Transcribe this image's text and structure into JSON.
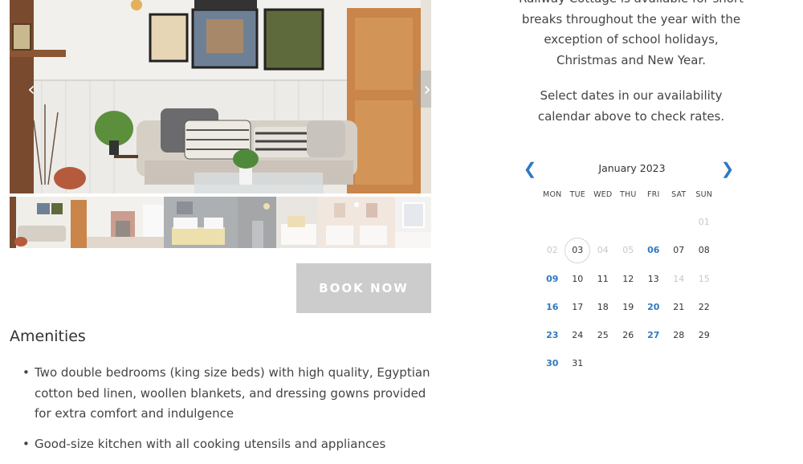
{
  "gallery": {
    "prev_icon": "chevron-left-icon",
    "next_icon": "chevron-right-icon",
    "thumbnails": [
      "living-room",
      "fireplace-room",
      "bedroom-yellow",
      "bedroom-dark",
      "bedroom-white",
      "bedroom-twin",
      "window-room"
    ]
  },
  "booking": {
    "button_label": "BOOK NOW"
  },
  "amenities": {
    "title": "Amenities",
    "items": [
      "Two double bedrooms (king size beds) with high quality, Egyptian cotton bed linen, woollen blankets, and dressing gowns provided for extra comfort and indulgence",
      "Good-size kitchen with all cooking utensils and appliances"
    ]
  },
  "info": {
    "paragraph1": "Railway Cottage is available for short breaks throughout the year with the exception of school holidays, Christmas and New Year.",
    "paragraph2": "Select dates in our availability calendar above to check rates."
  },
  "calendar": {
    "month": "January 2023",
    "prev_icon": "chevron-left-icon",
    "next_icon": "chevron-right-icon",
    "weekdays": [
      "MON",
      "TUE",
      "WED",
      "THU",
      "FRI",
      "SAT",
      "SUN"
    ],
    "accent_color": "#2e79c0",
    "weeks": [
      [
        {
          "d": ""
        },
        {
          "d": ""
        },
        {
          "d": ""
        },
        {
          "d": ""
        },
        {
          "d": ""
        },
        {
          "d": ""
        },
        {
          "d": "01",
          "s": "dim"
        }
      ],
      [
        {
          "d": "02",
          "s": "dim"
        },
        {
          "d": "03",
          "s": "today"
        },
        {
          "d": "04",
          "s": "dim"
        },
        {
          "d": "05",
          "s": "dim"
        },
        {
          "d": "06",
          "s": "avail"
        },
        {
          "d": "07"
        },
        {
          "d": "08"
        }
      ],
      [
        {
          "d": "09",
          "s": "avail"
        },
        {
          "d": "10"
        },
        {
          "d": "11"
        },
        {
          "d": "12"
        },
        {
          "d": "13"
        },
        {
          "d": "14",
          "s": "dim"
        },
        {
          "d": "15",
          "s": "dim"
        }
      ],
      [
        {
          "d": "16",
          "s": "avail"
        },
        {
          "d": "17"
        },
        {
          "d": "18"
        },
        {
          "d": "19"
        },
        {
          "d": "20",
          "s": "avail"
        },
        {
          "d": "21"
        },
        {
          "d": "22"
        }
      ],
      [
        {
          "d": "23",
          "s": "avail"
        },
        {
          "d": "24"
        },
        {
          "d": "25"
        },
        {
          "d": "26"
        },
        {
          "d": "27",
          "s": "avail"
        },
        {
          "d": "28"
        },
        {
          "d": "29"
        }
      ],
      [
        {
          "d": "30",
          "s": "avail"
        },
        {
          "d": "31"
        },
        {
          "d": ""
        },
        {
          "d": ""
        },
        {
          "d": ""
        },
        {
          "d": ""
        },
        {
          "d": ""
        }
      ]
    ]
  }
}
